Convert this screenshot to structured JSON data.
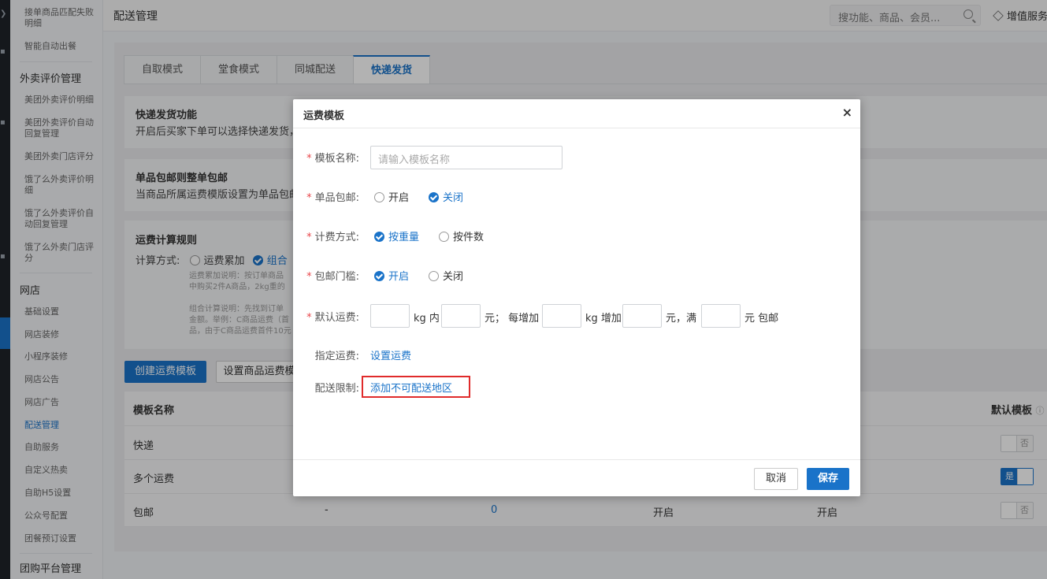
{
  "sidebar": {
    "items_top": [
      "接单商品匹配失败明细",
      "智能自动出餐"
    ],
    "group1": "外卖评价管理",
    "group1_items": [
      "美团外卖评价明细",
      "美团外卖评价自动回复管理",
      "美团外卖门店评分",
      "饿了么外卖评价明细",
      "饿了么外卖评价自动回复管理",
      "饿了么外卖门店评分"
    ],
    "group2": "网店",
    "group2_items": [
      "基础设置",
      "网店装修",
      "小程序装修",
      "网店公告",
      "网店广告",
      "配送管理",
      "自助服务",
      "自定义热卖",
      "自助H5设置",
      "公众号配置",
      "团餐预订设置"
    ],
    "group3": "团购平台管理",
    "active_item": "配送管理"
  },
  "topbar": {
    "title": "配送管理",
    "search_placeholder": "搜功能、商品、会员...",
    "vip_label": "增值服务"
  },
  "tabs": [
    "自取模式",
    "堂食模式",
    "同城配送",
    "快递发货"
  ],
  "active_tab": "快递发货",
  "section1": {
    "title": "快递发货功能",
    "desc": "开启后买家下单可以选择快递发货，"
  },
  "section2": {
    "title": "单品包邮则整单包邮",
    "desc": "当商品所属运费模版设置为单品包邮"
  },
  "section3": {
    "title": "运费计算规则",
    "label": "计算方式:",
    "option1": "运费累加",
    "option2": "组合",
    "note1a": "运费累加说明：按订单商品",
    "note1b": "中购买2件A商品，2kg重的",
    "note2a": "组合计算说明：先找到订单",
    "note2b": "金额。举例：C商品运费（首",
    "note2c": "品，由于C商品运费首件10元"
  },
  "buttons": {
    "create_template": "创建运费模板",
    "set_goods": "设置商品运费模"
  },
  "table": {
    "col_name": "模板名称",
    "col_default": "默认模板",
    "rows": [
      {
        "name": "快递",
        "switch": "否"
      },
      {
        "name": "多个运费",
        "switch": "是"
      },
      {
        "name": "包邮",
        "c2": "-",
        "c3": "0",
        "c4": "开启",
        "c5": "开启",
        "switch": "否"
      }
    ]
  },
  "modal": {
    "title": "运费模板",
    "close": "×",
    "template_name_label": "模板名称:",
    "template_name_placeholder": "请输入模板名称",
    "single_free_label": "单品包邮:",
    "single_free_opts": [
      "开启",
      "关闭"
    ],
    "single_free_selected": "关闭",
    "billing_label": "计费方式:",
    "billing_opts": [
      "按重量",
      "按件数"
    ],
    "billing_selected": "按重量",
    "threshold_label": "包邮门槛:",
    "threshold_opts": [
      "开启",
      "关闭"
    ],
    "threshold_selected": "开启",
    "default_fee_label": "默认运费:",
    "fee_text": [
      "kg 内",
      "元；  每增加",
      "kg 增加",
      "元，满",
      "元 包邮"
    ],
    "specify_label": "指定运费:",
    "specify_link": "设置运费",
    "limit_label": "配送限制:",
    "limit_link": "添加不可配送地区",
    "cancel": "取消",
    "save": "保存"
  },
  "colors": {
    "accent": "#1a73c9",
    "highlight_box": "#e02b2b",
    "required_star": "#e8464a"
  }
}
